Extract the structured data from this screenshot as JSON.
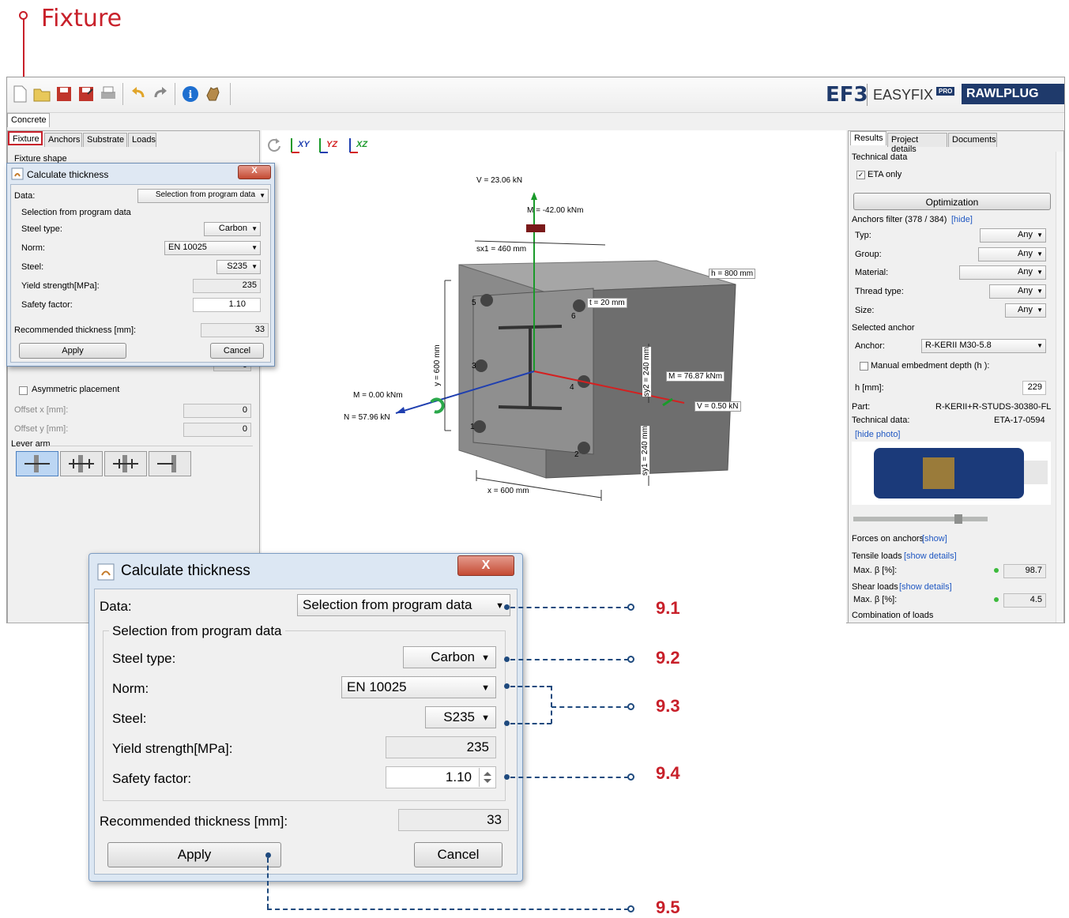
{
  "annotation": {
    "title": "Fixture"
  },
  "brand": {
    "logo": "EF3",
    "product": "EASYFIX",
    "product_badge": "PRO",
    "company": "RAWLPLUG"
  },
  "toolbar": {
    "icons": [
      "new-file-icon",
      "open-folder-icon",
      "save-icon",
      "save-as-icon",
      "print-icon",
      "undo-icon",
      "redo-icon",
      "info-icon",
      "hand-icon"
    ]
  },
  "tabs_top": {
    "concrete": "Concrete"
  },
  "left_panel": {
    "tabs": [
      "Fixture",
      "Anchors",
      "Substrate",
      "Loads"
    ],
    "fixture_shape": "Fixture shape",
    "asymmetric": "Asymmetric placement",
    "offset_x_label": "Offset x [mm]:",
    "offset_x_value": "0",
    "offset_y_label": "Offset y [mm]:",
    "offset_y_value": "0",
    "lever_arm": "Lever arm",
    "rotation_value": "0"
  },
  "viewport": {
    "planes": [
      "XY",
      "YZ",
      "XZ"
    ],
    "labels": {
      "vy": "V  = 23.06 kN",
      "my": "M  = -42.00 kNm",
      "sx1": "sx1 = 460 mm",
      "h": "h = 800 mm",
      "tfix": "t    = 20 mm",
      "mx": "M  = 76.87 kNm",
      "vx": "V  = 0.50 kN",
      "ms": "M  = 0.00 kNm",
      "n": "N = 57.96 kN",
      "y600": "y = 600 mm",
      "sy2": "sy2 = 240 mm",
      "sy1": "sy1 = 240 mm",
      "x600": "x = 600 mm"
    },
    "anchor_numbers": [
      "1",
      "2",
      "3",
      "4",
      "5",
      "6"
    ]
  },
  "right_panel": {
    "tabs": [
      "Results",
      "Project details",
      "Documents"
    ],
    "technical_data": "Technical data",
    "eta_only": "ETA only",
    "optimization": "Optimization",
    "anchors_filter": "Anchors filter (378 / 384)",
    "hide": "[hide]",
    "filters": [
      {
        "label": "Typ:",
        "value": "Any"
      },
      {
        "label": "Group:",
        "value": "Any"
      },
      {
        "label": "Material:",
        "value": "Any"
      },
      {
        "label": "Thread type:",
        "value": "Any"
      },
      {
        "label": "Size:",
        "value": "Any"
      }
    ],
    "selected_anchor": "Selected anchor",
    "anchor_label": "Anchor:",
    "anchor_value": "R-KERII M30-5.8",
    "manual_embed": "Manual embedment depth (h  ):",
    "hef_label": "h   [mm]:",
    "hef_value": "229",
    "part_label": "Part:",
    "part_value": "R-KERII+R-STUDS-30380-FL",
    "techdata_label": "Technical data:",
    "techdata_value": "ETA-17-0594",
    "hide_photo": "[hide photo]",
    "forces_on_anchors": "Forces on anchors",
    "show": "[show]",
    "tensile_loads": "Tensile loads",
    "show_details": "[show details]",
    "max_bn": "Max. β  [%]:",
    "max_bn_value": "98.7",
    "shear_loads": "Shear loads",
    "max_bv": "Max. β  [%]:",
    "max_bv_value": "4.5",
    "combination": "Combination of loads"
  },
  "dialog": {
    "title": "Calculate thickness",
    "data_label": "Data:",
    "data_value": "Selection from program data",
    "group_title": "Selection from program data",
    "steel_type_label": "Steel type:",
    "steel_type_value": "Carbon",
    "norm_label": "Norm:",
    "norm_value": "EN 10025",
    "steel_label": "Steel:",
    "steel_value": "S235",
    "yield_label": "Yield strength[MPa]:",
    "yield_value": "235",
    "safety_label": "Safety factor:",
    "safety_value": "1.10",
    "recommended_label": "Recommended thickness [mm]:",
    "recommended_value": "33",
    "apply": "Apply",
    "cancel": "Cancel",
    "close": "X"
  },
  "callouts": [
    "9.1",
    "9.2",
    "9.3",
    "9.4",
    "9.5"
  ],
  "colors": {
    "accent_red": "#c8202a",
    "callout_blue": "#1f4a7e",
    "link_blue": "#1f57c2"
  }
}
